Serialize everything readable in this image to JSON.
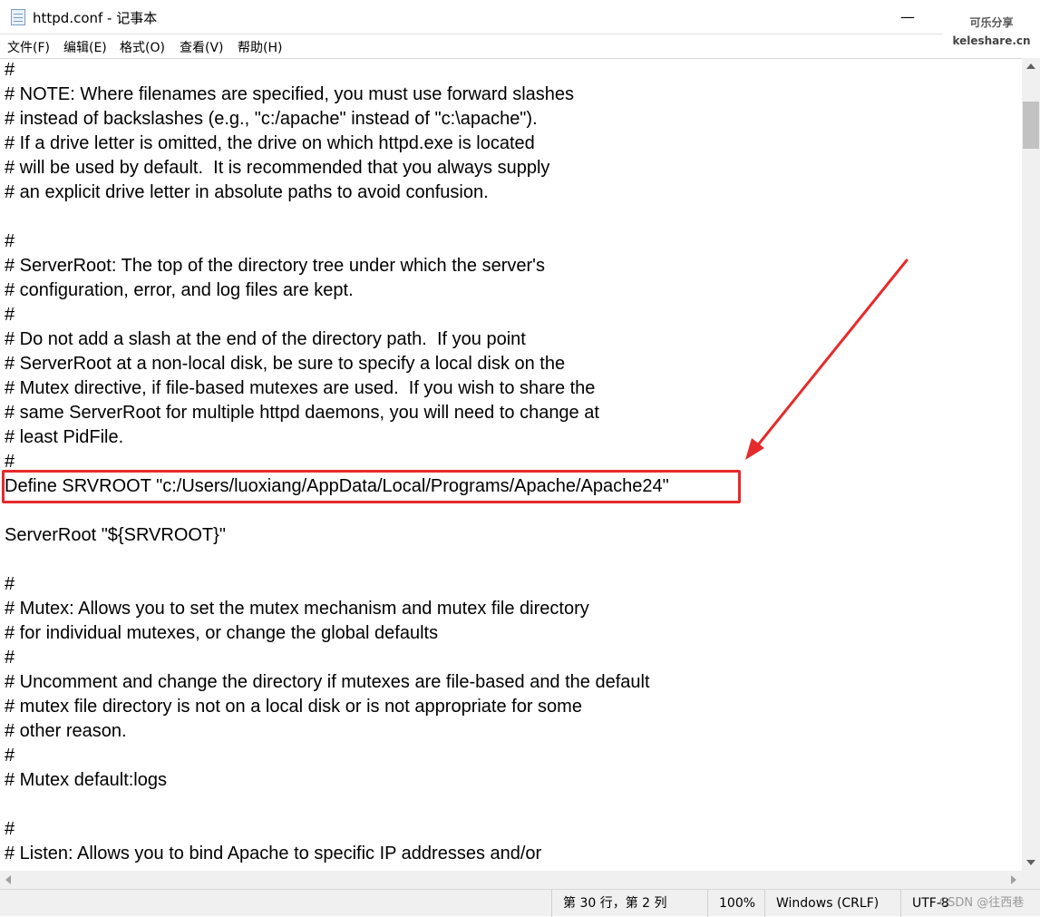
{
  "window": {
    "title": "httpd.conf - 记事本",
    "minimize": "—"
  },
  "watermark": {
    "line1": "可乐分享",
    "line2": "keleshare.cn"
  },
  "menu": [
    "文件(F)",
    "编辑(E)",
    "格式(O)",
    "查看(V)",
    "帮助(H)"
  ],
  "editor": {
    "lines": [
      "#",
      "# NOTE: Where filenames are specified, you must use forward slashes",
      "# instead of backslashes (e.g., \"c:/apache\" instead of \"c:\\apache\").",
      "# If a drive letter is omitted, the drive on which httpd.exe is located",
      "# will be used by default.  It is recommended that you always supply",
      "# an explicit drive letter in absolute paths to avoid confusion.",
      "",
      "#",
      "# ServerRoot: The top of the directory tree under which the server's",
      "# configuration, error, and log files are kept.",
      "#",
      "# Do not add a slash at the end of the directory path.  If you point",
      "# ServerRoot at a non-local disk, be sure to specify a local disk on the",
      "# Mutex directive, if file-based mutexes are used.  If you wish to share the",
      "# same ServerRoot for multiple httpd daemons, you will need to change at",
      "# least PidFile.",
      "#",
      "Define SRVROOT \"c:/Users/luoxiang/AppData/Local/Programs/Apache/Apache24\"",
      "",
      "ServerRoot \"${SRVROOT}\"",
      "",
      "#",
      "# Mutex: Allows you to set the mutex mechanism and mutex file directory",
      "# for individual mutexes, or change the global defaults",
      "#",
      "# Uncomment and change the directory if mutexes are file-based and the default",
      "# mutex file directory is not on a local disk or is not appropriate for some",
      "# other reason.",
      "#",
      "# Mutex default:logs",
      "",
      "#",
      "# Listen: Allows you to bind Apache to specific IP addresses and/or"
    ],
    "highlight_color": "#e52b2b"
  },
  "status": {
    "position": "第 30 行，第 2 列",
    "zoom": "100%",
    "line_ending": "Windows (CRLF)",
    "encoding": "UTF-8"
  },
  "credit": "CSDN @往西巷"
}
